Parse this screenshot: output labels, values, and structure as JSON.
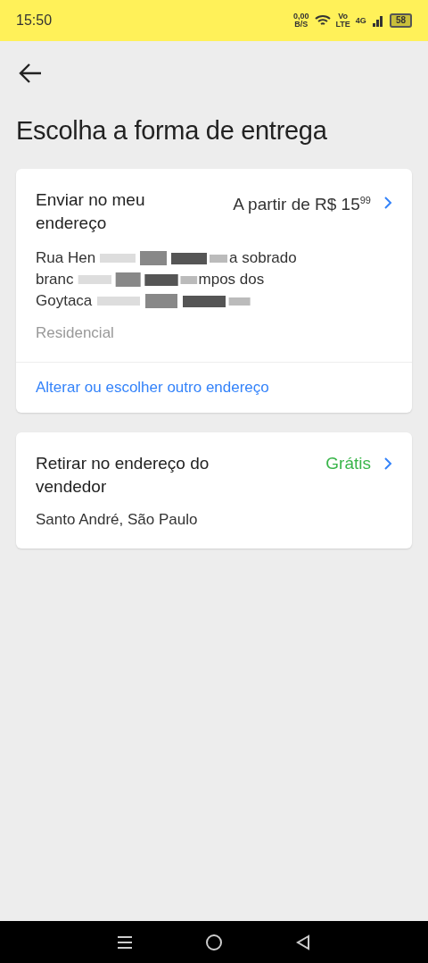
{
  "status_bar": {
    "time": "15:50",
    "net_speed": "0,00",
    "net_unit": "B/S",
    "volte_top": "Vo",
    "volte_bottom": "LTE",
    "network": "4G",
    "battery": "58"
  },
  "title": "Escolha a forma de entrega",
  "options": [
    {
      "kind": "delivery",
      "title": "Enviar no meu endereço",
      "price": "A partir de R$ 15$^{99}$",
      "free": false,
      "address_lines": [
        [
          "Rua Hen",
          "a sobrado"
        ],
        [
          "branc",
          "mpos dos"
        ],
        [
          "Goytaca"
        ]
      ],
      "address_type": "Residencial",
      "link": "Alterar ou escolher outro endereço"
    },
    {
      "kind": "pickup",
      "title": "Retirar no endereço do vendedor",
      "price": "Grátis",
      "free": true,
      "location": "Santo André, São Paulo"
    }
  ]
}
